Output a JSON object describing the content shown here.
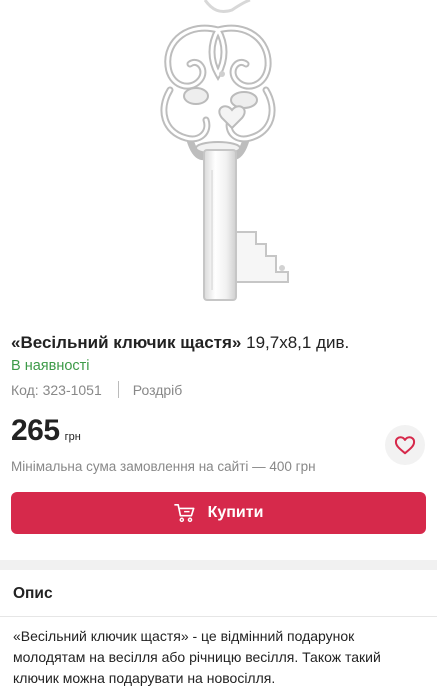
{
  "product": {
    "image_alt": "Весільний ключик щастя",
    "title_name": "«Весільний ключик щастя»",
    "title_size": "19,7х8,1 див.",
    "availability": "В наявності",
    "code": "Код: 323-1051",
    "sale_type": "Роздріб",
    "price": "265",
    "currency": "грн",
    "min_order": "Мінімальна сума замовлення на сайті — 400 грн",
    "buy_label": "Купити"
  },
  "colors": {
    "accent": "#d6294b",
    "availability": "#3d9a48"
  },
  "icons": {
    "favorite": "heart-outline-icon",
    "cart": "cart-icon"
  },
  "description": {
    "heading": "Опис",
    "text": "«Весільний ключик щастя» - це відмінний подарунок молодятам на весілля або річницю весілля. Також такий ключик можна подарувати на новосілля."
  }
}
